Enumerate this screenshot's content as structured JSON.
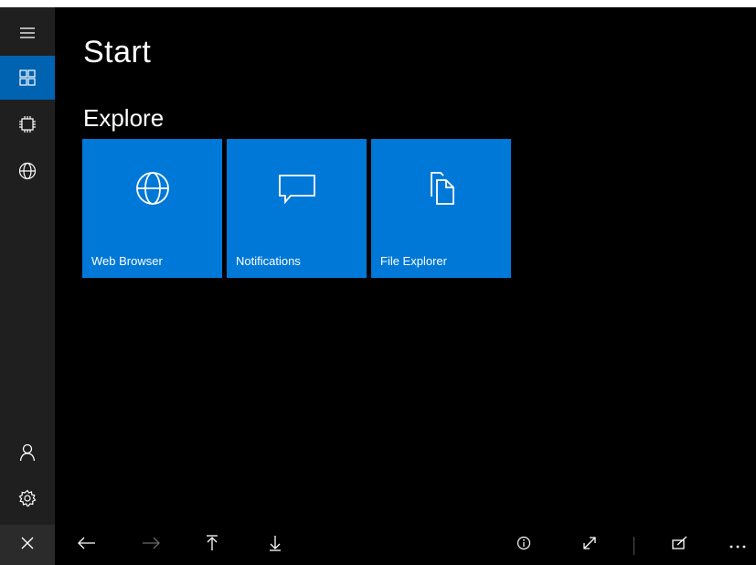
{
  "page": {
    "title": "Start"
  },
  "section": {
    "title": "Explore"
  },
  "tiles": [
    {
      "label": "Web Browser",
      "icon": "globe-icon"
    },
    {
      "label": "Notifications",
      "icon": "speech-bubble-icon"
    },
    {
      "label": "File Explorer",
      "icon": "documents-icon"
    }
  ],
  "sidebar": {
    "items": [
      {
        "icon": "hamburger-menu-icon"
      },
      {
        "icon": "tiles-grid-icon",
        "active": true
      },
      {
        "icon": "chip-icon"
      },
      {
        "icon": "globe-icon"
      },
      {
        "icon": "person-icon"
      },
      {
        "icon": "settings-gear-icon"
      },
      {
        "icon": "close-icon"
      }
    ]
  },
  "bottombar": {
    "items": [
      {
        "icon": "back-arrow-icon",
        "enabled": true
      },
      {
        "icon": "forward-arrow-icon",
        "enabled": false
      },
      {
        "icon": "upload-icon",
        "enabled": true
      },
      {
        "icon": "download-icon",
        "enabled": true
      },
      {
        "icon": "info-icon",
        "enabled": true
      },
      {
        "icon": "expand-icon",
        "enabled": true
      },
      {
        "icon": "edit-icon",
        "enabled": true
      },
      {
        "icon": "more-options-icon",
        "enabled": true
      }
    ]
  },
  "colors": {
    "accent": "#0078d7",
    "sidebar_active": "#0063b1",
    "sidebar_bg": "#1f1f1f",
    "background": "#000000"
  }
}
